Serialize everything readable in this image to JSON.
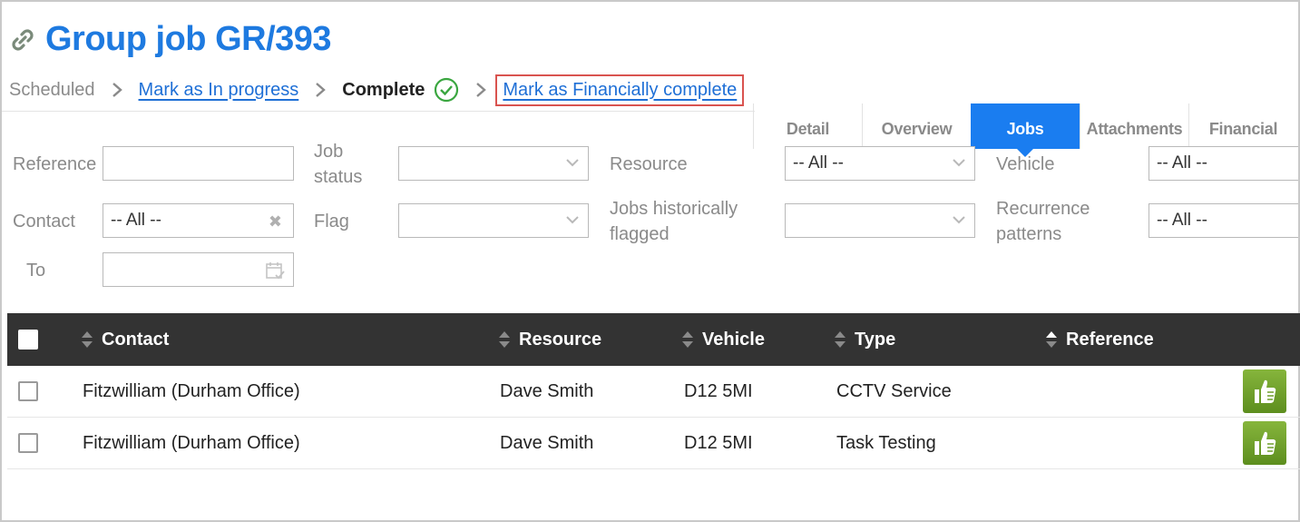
{
  "header": {
    "title": "Group job GR/393",
    "icon": "link-icon"
  },
  "status": {
    "scheduled": "Scheduled",
    "in_progress_link": "Mark as In progress",
    "complete": "Complete",
    "financial_link": "Mark as Financially complete"
  },
  "tabs": [
    {
      "label": "Detail"
    },
    {
      "label": "Overview"
    },
    {
      "label": "Jobs",
      "active": true
    },
    {
      "label": "Attachments"
    },
    {
      "label": "Financial"
    }
  ],
  "filters": {
    "reference": {
      "label": "Reference",
      "value": ""
    },
    "job_status": {
      "label": "Job status",
      "value": ""
    },
    "resource": {
      "label": "Resource",
      "value": "-- All --"
    },
    "vehicle": {
      "label": "Vehicle",
      "value": "-- All --"
    },
    "contact": {
      "label": "Contact",
      "value": "-- All --"
    },
    "flag": {
      "label": "Flag",
      "value": ""
    },
    "jobs_hist_flagged": {
      "label": "Jobs historically flagged",
      "value": ""
    },
    "recurrence": {
      "label": "Recurrence patterns",
      "value": "-- All --"
    },
    "to": {
      "label": "To",
      "value": ""
    }
  },
  "table": {
    "columns": {
      "contact": "Contact",
      "resource": "Resource",
      "vehicle": "Vehicle",
      "type": "Type",
      "reference": "Reference"
    },
    "rows": [
      {
        "contact": "Fitzwilliam (Durham Office)",
        "resource": "Dave Smith",
        "vehicle": "D12 5MI",
        "type": "CCTV Service",
        "reference": ""
      },
      {
        "contact": "Fitzwilliam (Durham Office)",
        "resource": "Dave Smith",
        "vehicle": "D12 5MI",
        "type": "Task Testing",
        "reference": ""
      }
    ]
  },
  "colors": {
    "accent": "#1e7ae0",
    "tab_active": "#1a7df0",
    "header_bg": "#333333",
    "highlight_border": "#d9534f",
    "approve_green": "#6f9e2a"
  }
}
